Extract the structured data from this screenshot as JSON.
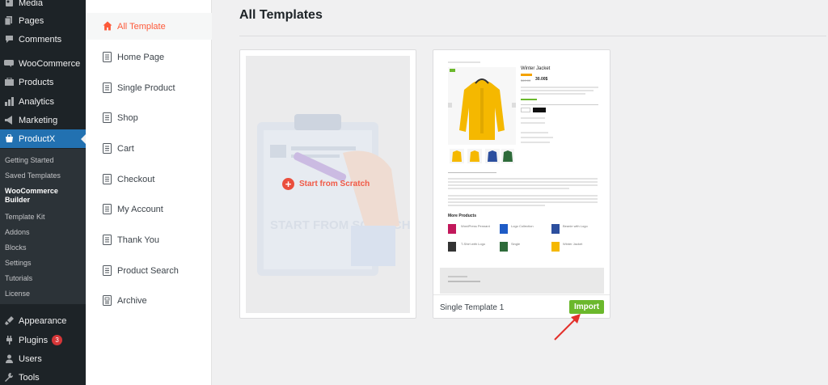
{
  "wp_menu": {
    "items": [
      {
        "label": "Media",
        "icon": "media-icon"
      },
      {
        "label": "Pages",
        "icon": "pages-icon"
      },
      {
        "label": "Comments",
        "icon": "comments-icon"
      },
      {
        "label": "WooCommerce",
        "icon": "woocommerce-icon"
      },
      {
        "label": "Products",
        "icon": "products-icon"
      },
      {
        "label": "Analytics",
        "icon": "analytics-icon"
      },
      {
        "label": "Marketing",
        "icon": "marketing-icon"
      },
      {
        "label": "ProductX",
        "icon": "productx-icon"
      },
      {
        "label": "Appearance",
        "icon": "appearance-icon"
      },
      {
        "label": "Plugins",
        "icon": "plugins-icon",
        "badge": "3"
      },
      {
        "label": "Users",
        "icon": "users-icon"
      },
      {
        "label": "Tools",
        "icon": "tools-icon"
      }
    ],
    "productx_submenu": [
      "Getting Started",
      "Saved Templates",
      "WooCommerce Builder",
      "Template Kit",
      "Addons",
      "Blocks",
      "Settings",
      "Tutorials",
      "License"
    ],
    "colors": {
      "bg": "#1d2327",
      "active": "#2271b1",
      "submenu_bg": "#2c3338",
      "badge": "#d63638"
    }
  },
  "categories": [
    {
      "label": "All Template",
      "icon": "home-icon"
    },
    {
      "label": "Home Page",
      "icon": "page-icon"
    },
    {
      "label": "Single Product",
      "icon": "page-icon"
    },
    {
      "label": "Shop",
      "icon": "page-icon"
    },
    {
      "label": "Cart",
      "icon": "page-icon"
    },
    {
      "label": "Checkout",
      "icon": "page-icon"
    },
    {
      "label": "My Account",
      "icon": "page-icon"
    },
    {
      "label": "Thank You",
      "icon": "page-icon"
    },
    {
      "label": "Product Search",
      "icon": "page-icon"
    },
    {
      "label": "Archive",
      "icon": "archive-icon"
    }
  ],
  "main": {
    "title": "All Templates",
    "scratch": {
      "label": "Start from Scratch",
      "illustration_text": "START FROM SCRATCH"
    },
    "template_card": {
      "name": "Single Template 1",
      "import_label": "Import",
      "accent": "#6bb82c"
    },
    "preview": {
      "product_title": "Winter Jacket",
      "price": "30.00$",
      "old_price": "$40.00",
      "section_title": "More Products",
      "related": [
        {
          "name": "WordPress Pennant",
          "color": "#c2185b"
        },
        {
          "name": "Logo Collection",
          "color": "#1e5bc6"
        },
        {
          "name": "Beanie with Logo",
          "color": "#2c4f9e"
        },
        {
          "name": "T-Shirt with Logo",
          "color": "#333333"
        },
        {
          "name": "Single",
          "color": "#2e6b3a"
        },
        {
          "name": "Winter Jacket",
          "color": "#f5b800"
        }
      ]
    }
  }
}
